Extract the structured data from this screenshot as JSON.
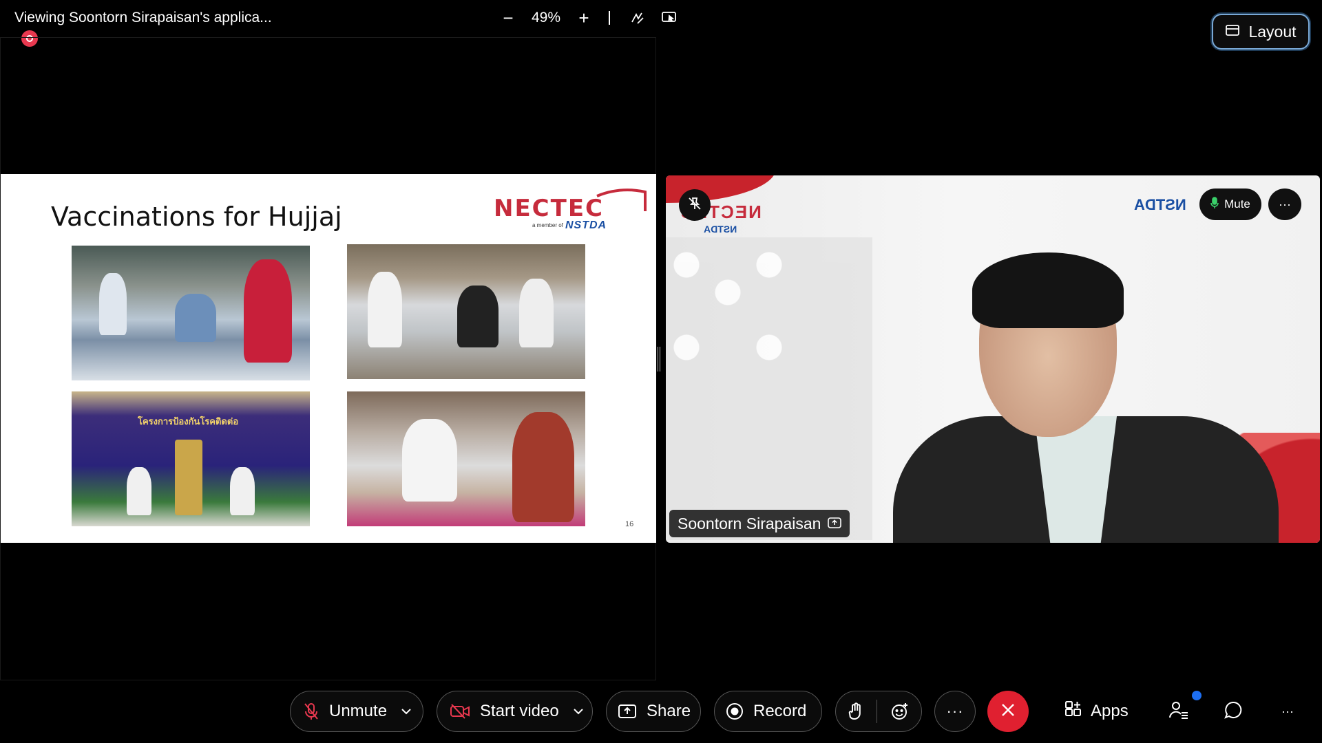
{
  "header": {
    "share_title": "Viewing Soontorn Sirapaisan's applica...",
    "zoom_value": "49%",
    "zoom_out": "−",
    "zoom_in": "+",
    "layout_label": "Layout"
  },
  "slide": {
    "title": "Vaccinations for Hujjaj",
    "logo_text": "NECTEC",
    "logo_sub": "a member of",
    "logo_org": "NSTDA",
    "banner_text": "โครงการป้องกันโรคติดต่อ",
    "page_number": "16"
  },
  "video": {
    "participant_name": "Soontorn Sirapaisan",
    "mute_label": "Mute",
    "more_label": "···",
    "bg_logo_left": "NECTEC",
    "bg_logo_left_sub": "NSTDA",
    "bg_logo_right": "NSTDA"
  },
  "toolbar": {
    "unmute_label": "Unmute",
    "start_video_label": "Start video",
    "share_label": "Share",
    "record_label": "Record",
    "more_label": "···",
    "apps_label": "Apps",
    "overflow_label": "···"
  },
  "colors": {
    "end_call": "#e02030",
    "recording": "#e8384f",
    "notification": "#1d6ff2",
    "layout_border": "#7aa9d6"
  }
}
